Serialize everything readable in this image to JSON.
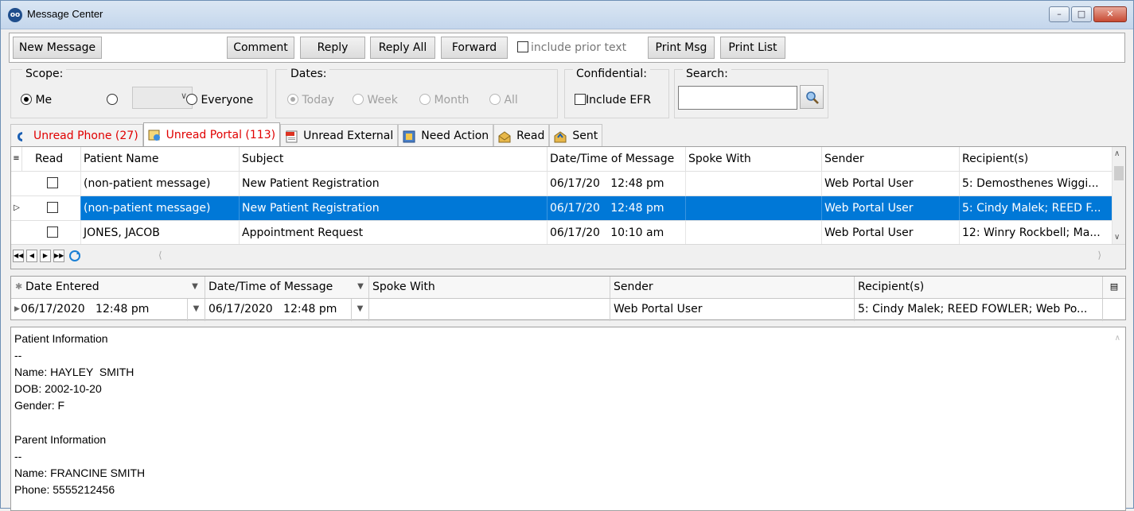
{
  "window": {
    "title": "Message Center",
    "app_icon": "oo"
  },
  "toolbar": {
    "new_message": "New Message",
    "comment": "Comment",
    "reply": "Reply",
    "reply_all": "Reply All",
    "forward": "Forward",
    "include_prior_text": "include prior text",
    "print_msg": "Print Msg",
    "print_list": "Print List"
  },
  "filters": {
    "scope": {
      "label": "Scope:",
      "me": "Me",
      "everyone": "Everyone"
    },
    "dates": {
      "label": "Dates:",
      "today": "Today",
      "week": "Week",
      "month": "Month",
      "all": "All"
    },
    "confidential": {
      "label": "Confidential:",
      "include_efr": "Include EFR"
    },
    "search": {
      "label": "Search:",
      "value": ""
    }
  },
  "tabs": [
    {
      "label": "Unread Phone (27)"
    },
    {
      "label": "Unread Portal (113)"
    },
    {
      "label": "Unread External"
    },
    {
      "label": "Need Action"
    },
    {
      "label": "Read"
    },
    {
      "label": "Sent"
    }
  ],
  "grid": {
    "columns": [
      "Read",
      "Patient Name",
      "Subject",
      "Date/Time of Message",
      "Spoke With",
      "Sender",
      "Recipient(s)"
    ],
    "rows": [
      {
        "patient": "(non-patient message)",
        "subject": "New Patient Registration",
        "datetime": "06/17/20   12:48 pm",
        "spoke_with": "",
        "sender": "Web Portal User",
        "recipients": "5: Demosthenes Wiggi..."
      },
      {
        "patient": "(non-patient message)",
        "subject": "New Patient Registration",
        "datetime": "06/17/20   12:48 pm",
        "spoke_with": "",
        "sender": "Web Portal User",
        "recipients": "5: Cindy Malek; REED F..."
      },
      {
        "patient": "JONES, JACOB",
        "subject": "Appointment Request",
        "datetime": "06/17/20   10:10 am",
        "spoke_with": "",
        "sender": "Web Portal User",
        "recipients": "12: Winry Rockbell; Ma..."
      }
    ]
  },
  "detail": {
    "columns": [
      "Date Entered",
      "Date/Time of Message",
      "Spoke With",
      "Sender",
      "Recipient(s)"
    ],
    "row": {
      "date_entered": "06/17/2020   12:48 pm",
      "datetime": "06/17/2020   12:48 pm",
      "spoke_with": "",
      "sender": "Web Portal User",
      "recipients": "5: Cindy Malek; REED FOWLER; Web Po..."
    }
  },
  "message_body": [
    "Patient Information",
    "--",
    "Name: HAYLEY  SMITH",
    "DOB: 2002-10-20",
    "Gender: F",
    "",
    "Parent Information",
    "--",
    "Name: FRANCINE SMITH",
    "Phone: 5555212456"
  ]
}
